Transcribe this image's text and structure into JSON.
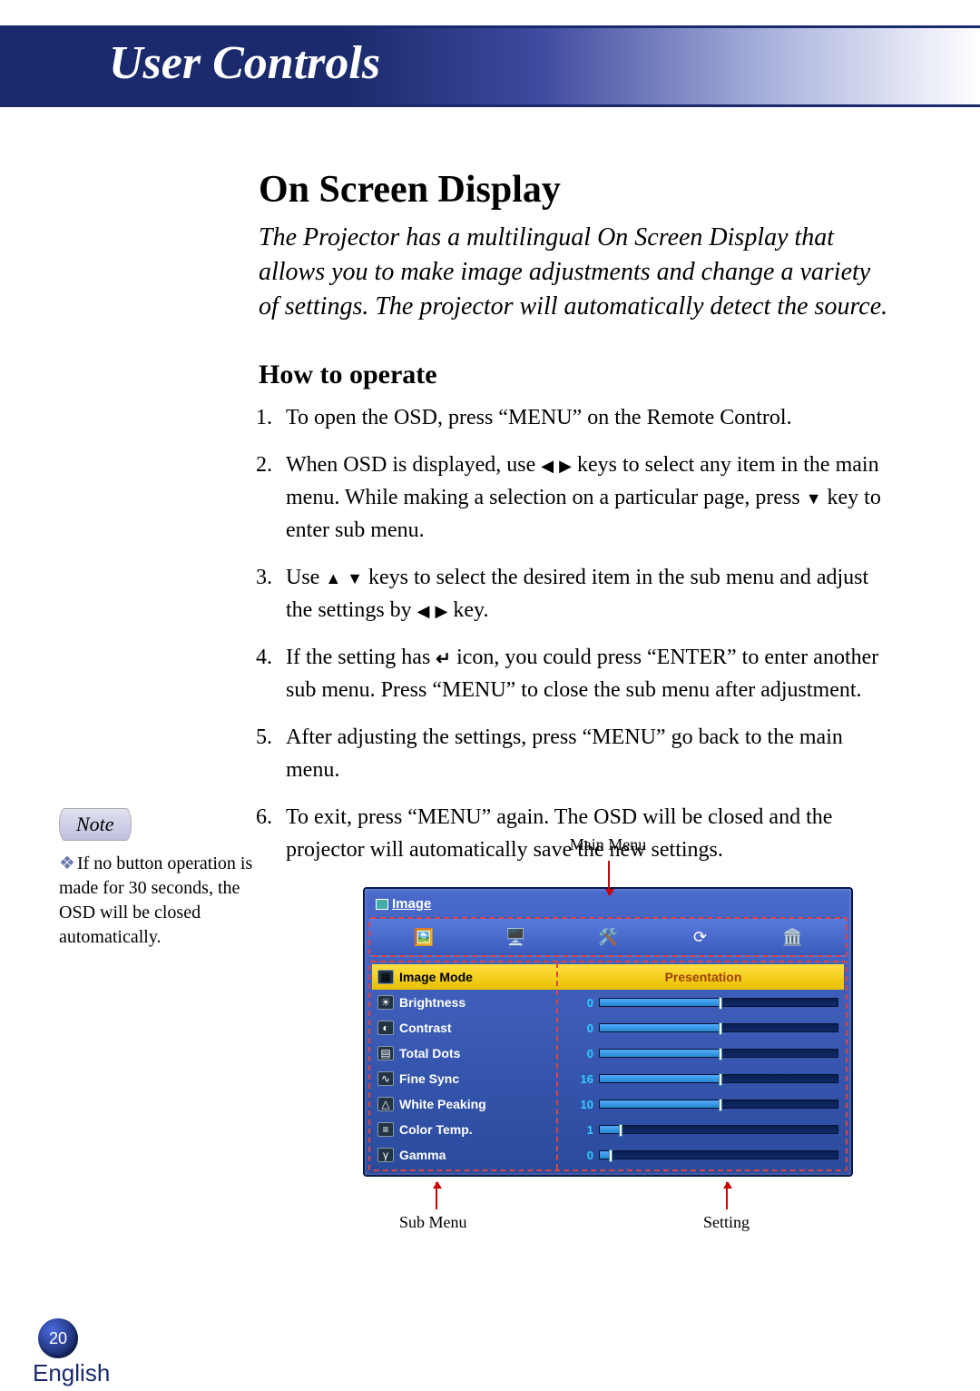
{
  "header": {
    "title": "User Controls"
  },
  "section": {
    "title": "On Screen Display",
    "intro": "The Projector has a multilingual On Screen Display that allows you to make image adjustments and change a variety of settings. The projector will automatically detect the source.",
    "subtitle": "How to operate"
  },
  "steps": {
    "s1": "To open the OSD, press “MENU” on the Remote Control.",
    "s2a": "When OSD is displayed, use ",
    "s2b": " keys to select any item in the main menu. While making a selection on a particular page, press ",
    "s2c": " key to enter sub menu.",
    "s3a": "Use ",
    "s3b": " keys to select the desired item in the sub menu and adjust the settings by ",
    "s3c": " key.",
    "s4a": "If the setting has ",
    "s4b": " icon, you could press “ENTER” to enter another sub menu. Press “MENU” to close the sub menu after adjustment.",
    "s5": "After adjusting the settings, press “MENU” go back to the main menu.",
    "s6": "To exit, press “MENU” again. The OSD will be closed and the projector will automatically save the new settings."
  },
  "note": {
    "label": "Note",
    "text": "If no button operation is made for 30 seconds, the OSD will be closed automatically."
  },
  "osd": {
    "main_menu_label": "Main Menu",
    "sub_menu_label": "Sub Menu",
    "setting_label": "Setting",
    "tab_title": "Image",
    "items": [
      {
        "label": "Image Mode",
        "value": "Presentation",
        "type": "preset"
      },
      {
        "label": "Brightness",
        "value": 0,
        "type": "slider"
      },
      {
        "label": "Contrast",
        "value": 0,
        "type": "slider"
      },
      {
        "label": "Total Dots",
        "value": 0,
        "type": "slider"
      },
      {
        "label": "Fine Sync",
        "value": 16,
        "type": "slider"
      },
      {
        "label": "White Peaking",
        "value": 10,
        "type": "slider"
      },
      {
        "label": "Color Temp.",
        "value": 1,
        "type": "slider"
      },
      {
        "label": "Gamma",
        "value": 0,
        "type": "slider"
      }
    ]
  },
  "footer": {
    "page": "20",
    "language": "English"
  }
}
